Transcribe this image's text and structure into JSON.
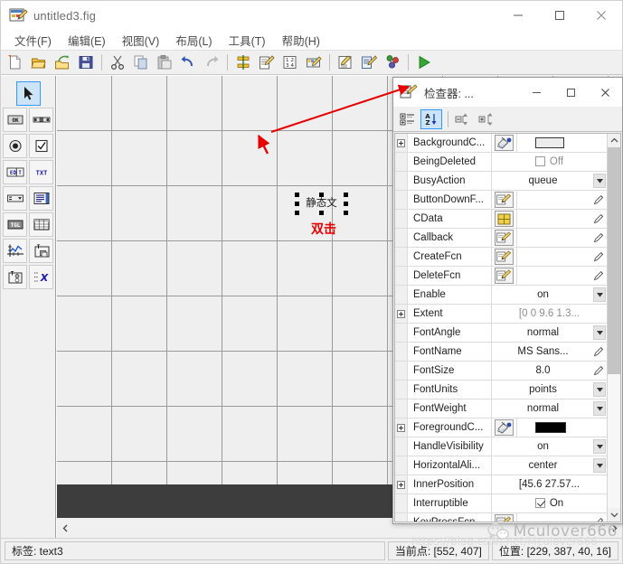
{
  "window": {
    "title": "untitled3.fig",
    "icon": "guide-figure-icon",
    "controls": {
      "minimize": "—",
      "maximize": "☐",
      "close": "✕"
    }
  },
  "menubar": {
    "items": [
      {
        "label": "文件(F)",
        "name": "menu-file"
      },
      {
        "label": "编辑(E)",
        "name": "menu-edit"
      },
      {
        "label": "视图(V)",
        "name": "menu-view"
      },
      {
        "label": "布局(L)",
        "name": "menu-layout"
      },
      {
        "label": "工具(T)",
        "name": "menu-tools"
      },
      {
        "label": "帮助(H)",
        "name": "menu-help"
      }
    ]
  },
  "toolbar": {
    "buttons": [
      {
        "name": "new-file-icon",
        "glyph": "new"
      },
      {
        "name": "open-file-icon",
        "glyph": "open"
      },
      {
        "name": "export-icon",
        "glyph": "export"
      },
      {
        "name": "save-icon",
        "glyph": "save"
      },
      {
        "sep": true
      },
      {
        "name": "cut-icon",
        "glyph": "cut"
      },
      {
        "name": "copy-icon",
        "glyph": "copy"
      },
      {
        "name": "paste-icon",
        "glyph": "paste"
      },
      {
        "name": "undo-icon",
        "glyph": "undo"
      },
      {
        "name": "redo-icon",
        "glyph": "redo"
      },
      {
        "sep": true
      },
      {
        "name": "align-objects-icon",
        "glyph": "align"
      },
      {
        "name": "menu-editor-icon",
        "glyph": "menued"
      },
      {
        "name": "tab-order-editor-icon",
        "glyph": "taborder"
      },
      {
        "name": "toolbar-editor-icon",
        "glyph": "tbedit"
      },
      {
        "sep": true
      },
      {
        "name": "m-file-editor-icon",
        "glyph": "mfile"
      },
      {
        "name": "property-inspector-icon",
        "glyph": "propinsp"
      },
      {
        "name": "object-browser-icon",
        "glyph": "objbrowser"
      },
      {
        "sep": true
      },
      {
        "name": "run-figure-icon",
        "glyph": "run"
      }
    ]
  },
  "palette": {
    "buttons": [
      {
        "name": "tool-select-arrow",
        "glyph": "arrow",
        "selected": true
      },
      {
        "name": "tool-push-button",
        "glyph": "OK",
        "selected": false
      },
      {
        "name": "tool-slider",
        "glyph": "slider",
        "selected": false
      },
      {
        "name": "tool-radio-button",
        "glyph": "radio",
        "selected": false
      },
      {
        "name": "tool-check-box",
        "glyph": "check",
        "selected": false
      },
      {
        "name": "tool-edit-text",
        "glyph": "EDIT",
        "selected": false
      },
      {
        "name": "tool-static-text",
        "glyph": "TXT",
        "selected": false
      },
      {
        "name": "tool-pop-up-menu",
        "glyph": "popup",
        "selected": false
      },
      {
        "name": "tool-list-box",
        "glyph": "listbox",
        "selected": false
      },
      {
        "name": "tool-toggle-button",
        "glyph": "TGL",
        "selected": false
      },
      {
        "name": "tool-table",
        "glyph": "table",
        "selected": false
      },
      {
        "name": "tool-axes",
        "glyph": "axes",
        "selected": false
      },
      {
        "name": "tool-panel",
        "glyph": "panel",
        "selected": false
      },
      {
        "name": "tool-button-group",
        "glyph": "btngroup",
        "selected": false
      },
      {
        "name": "tool-activex-control",
        "glyph": "activex",
        "selected": false
      }
    ]
  },
  "canvas": {
    "selected_object": {
      "label": "静态文",
      "name": "static-text-object"
    },
    "annotation": {
      "text": "双击",
      "color": "#e60000"
    }
  },
  "inspector": {
    "title": "检查器: ...",
    "icon": "inspector-icon",
    "controls": {
      "minimize": "—",
      "maximize": "☐",
      "close": "✕"
    },
    "toolbar": [
      {
        "name": "categorized-view-button",
        "active": false
      },
      {
        "name": "alphabetical-sort-button",
        "active": true
      },
      {
        "name": "collapse-all-button",
        "active": false
      },
      {
        "name": "expand-all-button",
        "active": false
      }
    ],
    "properties": [
      {
        "name": "BackgroundC...",
        "value": "",
        "kind": "color-white",
        "expandable": true,
        "row": "row-backgroundcolor"
      },
      {
        "name": "BeingDeleted",
        "value": "Off",
        "kind": "checkbox-off",
        "expandable": false,
        "row": "row-beingdeleted"
      },
      {
        "name": "BusyAction",
        "value": "queue",
        "kind": "combo",
        "expandable": false,
        "row": "row-busyaction"
      },
      {
        "name": "ButtonDownF...",
        "value": "",
        "kind": "fcn",
        "expandable": false,
        "row": "row-buttondownfcn"
      },
      {
        "name": "CData",
        "value": "",
        "kind": "cdata",
        "expandable": false,
        "row": "row-cdata"
      },
      {
        "name": "Callback",
        "value": "",
        "kind": "fcn",
        "expandable": false,
        "row": "row-callback"
      },
      {
        "name": "CreateFcn",
        "value": "",
        "kind": "fcn",
        "expandable": false,
        "row": "row-createfcn"
      },
      {
        "name": "DeleteFcn",
        "value": "",
        "kind": "fcn",
        "expandable": false,
        "row": "row-deletefcn"
      },
      {
        "name": "Enable",
        "value": "on",
        "kind": "combo",
        "expandable": false,
        "row": "row-enable"
      },
      {
        "name": "Extent",
        "value": "[0 0 9.6 1.3...",
        "kind": "dim-text",
        "expandable": true,
        "row": "row-extent"
      },
      {
        "name": "FontAngle",
        "value": "normal",
        "kind": "combo",
        "expandable": false,
        "row": "row-fontangle"
      },
      {
        "name": "FontName",
        "value": "MS Sans...",
        "kind": "text-pencil",
        "expandable": false,
        "row": "row-fontname"
      },
      {
        "name": "FontSize",
        "value": "8.0",
        "kind": "text-pencil",
        "expandable": false,
        "row": "row-fontsize"
      },
      {
        "name": "FontUnits",
        "value": "points",
        "kind": "combo",
        "expandable": false,
        "row": "row-fontunits"
      },
      {
        "name": "FontWeight",
        "value": "normal",
        "kind": "combo",
        "expandable": false,
        "row": "row-fontweight"
      },
      {
        "name": "ForegroundC...",
        "value": "",
        "kind": "color-black",
        "expandable": true,
        "row": "row-foregroundcolor"
      },
      {
        "name": "HandleVisibility",
        "value": "on",
        "kind": "combo",
        "expandable": false,
        "row": "row-handlevisibility"
      },
      {
        "name": "HorizontalAli...",
        "value": "center",
        "kind": "combo",
        "expandable": false,
        "row": "row-horizontalalignment"
      },
      {
        "name": "InnerPosition",
        "value": "[45.6 27.57...",
        "kind": "plain-text",
        "expandable": true,
        "row": "row-innerposition"
      },
      {
        "name": "Interruptible",
        "value": "On",
        "kind": "checkbox-on",
        "expandable": false,
        "row": "row-interruptible"
      },
      {
        "name": "KeyPressFcn",
        "value": "",
        "kind": "fcn",
        "expandable": false,
        "row": "row-keypressfcn"
      }
    ],
    "scrollbar": {
      "thumb_percent": 63
    }
  },
  "statusbar": {
    "tag_label": "标签: text3",
    "current_point_label": "当前点:  [552, 407]",
    "position_label": "位置: [229, 387, 40, 16]"
  },
  "watermark": {
    "text": "Mculover666",
    "url": "https://blog.csdn.net/Mculover666"
  }
}
